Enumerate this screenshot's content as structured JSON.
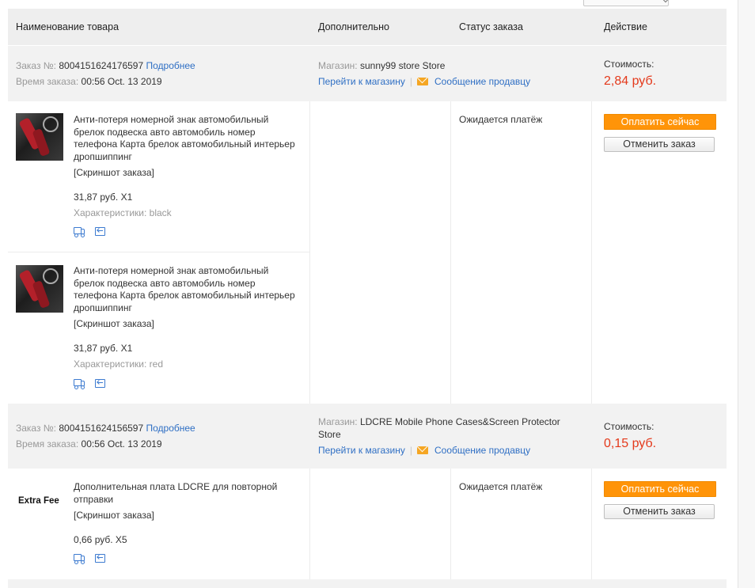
{
  "header": {
    "col_product": "Наименование товара",
    "col_extra": "Дополнительно",
    "col_status": "Статус заказа",
    "col_action": "Действие"
  },
  "labels": {
    "order_no": "Заказ №:",
    "order_time": "Время заказа:",
    "details": "Подробнее",
    "store": "Магазин:",
    "go_to_store": "Перейти к магазину",
    "message_seller": "Сообщение продавцу",
    "cost": "Стоимость:",
    "screenshot": "[Скриншот заказа]",
    "characteristics": "Характеристики:",
    "pay_now": "Оплатить сейчас",
    "cancel_order": "Отменить заказ"
  },
  "orders": [
    {
      "number": "8004151624176597",
      "time": "00:56 Oct. 13 2019",
      "store_name": "sunny99 store Store",
      "cost": "2,84 руб.",
      "status": "Ожидается платёж",
      "items": [
        {
          "title": "Анти-потеря номерной знак автомобильный брелок подвеска авто автомобиль номер телефона Карта брелок автомобильный интерьер дропшиппинг",
          "price_qty": "31,87 руб. X1",
          "characteristic": "black"
        },
        {
          "title": "Анти-потеря номерной знак автомобильный брелок подвеска авто автомобиль номер телефона Карта брелок автомобильный интерьер дропшиппинг",
          "price_qty": "31,87 руб. X1",
          "characteristic": "red"
        }
      ]
    },
    {
      "number": "8004151624156597",
      "time": "00:56 Oct. 13 2019",
      "store_name_line1": "LDCRE Mobile Phone Cases&Screen Protector",
      "store_name_line2": "Store",
      "cost": "0,15 руб.",
      "status": "Ожидается платёж",
      "items": [
        {
          "thumb_text": "Extra Fee",
          "title": "Дополнительная плата LDCRE для повторной отправки",
          "price_qty": "0,66 руб. X5"
        }
      ]
    }
  ],
  "icons": {
    "shipping": "truck-icon",
    "return": "return-icon",
    "message": "envelope-icon"
  },
  "colors": {
    "link": "#2f6fc4",
    "price": "#e4391b",
    "pay_button": "#ff9408",
    "header_bg": "#eeeeee"
  }
}
